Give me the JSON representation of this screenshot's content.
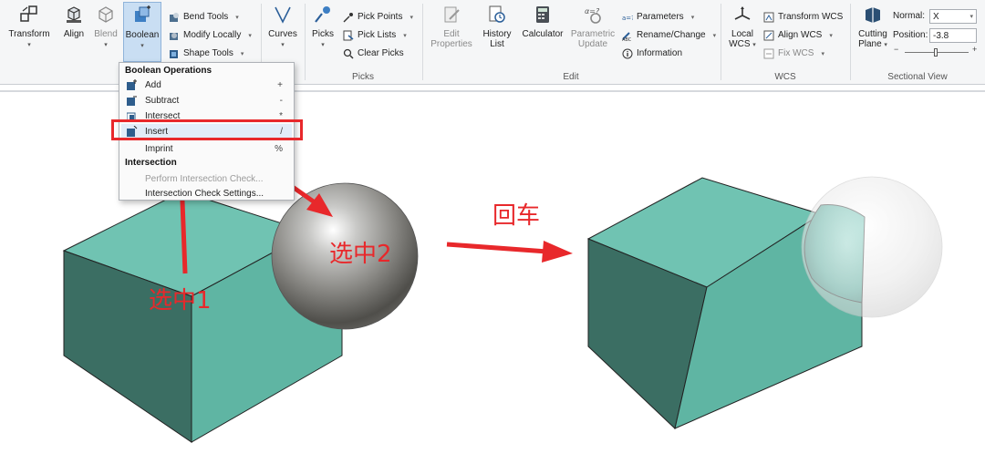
{
  "ribbon": {
    "transform": "Transform",
    "align": "Align",
    "blend": "Blend",
    "boolean": "Boolean",
    "bend_tools": "Bend Tools",
    "modify_locally": "Modify Locally",
    "shape_tools": "Shape Tools",
    "curves": "Curves",
    "picks": "Picks",
    "pick_points": "Pick Points",
    "pick_lists": "Pick Lists",
    "clear_picks": "Clear Picks",
    "picks_group": "Picks",
    "edit_properties_1": "Edit",
    "edit_properties_2": "Properties",
    "history_1": "History",
    "history_2": "List",
    "calculator": "Calculator",
    "parametric_1": "Parametric",
    "parametric_2": "Update",
    "parameters": "Parameters",
    "rename_change": "Rename/Change",
    "information": "Information",
    "edit_group": "Edit",
    "local_wcs_1": "Local",
    "local_wcs_2": "WCS",
    "transform_wcs": "Transform WCS",
    "align_wcs": "Align WCS",
    "fix_wcs": "Fix WCS",
    "wcs_group": "WCS",
    "cutting_plane_1": "Cutting",
    "cutting_plane_2": "Plane",
    "normal_label": "Normal:",
    "normal_value": "X",
    "position_label": "Position:",
    "position_value": "-3.8",
    "sectional_group": "Sectional View"
  },
  "menu": {
    "header_boolean": "Boolean Operations",
    "items": [
      {
        "label": "Add",
        "key": "+"
      },
      {
        "label": "Subtract",
        "key": "-"
      },
      {
        "label": "Intersect",
        "key": "*"
      },
      {
        "label": "Insert",
        "key": "/"
      },
      {
        "label": "Imprint",
        "key": "%"
      }
    ],
    "header_intersection": "Intersection",
    "perform_check": "Perform Intersection Check...",
    "check_settings": "Intersection Check Settings..."
  },
  "annotations": {
    "select1": "选中1",
    "select2": "选中2",
    "enter": "回车"
  },
  "colors": {
    "box_top": "#70c3b2",
    "box_front": "#5fb5a3",
    "box_side": "#3b6e63",
    "arrow": "#e8282b"
  }
}
